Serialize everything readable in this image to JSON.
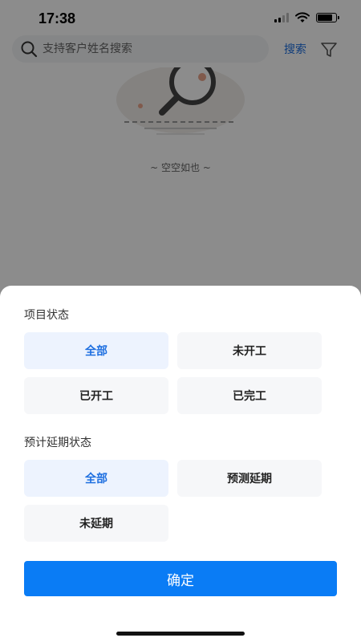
{
  "status_bar": {
    "time": "17:38",
    "icons": [
      "signal-icon",
      "wifi-icon",
      "battery-icon"
    ]
  },
  "search": {
    "placeholder": "支持客户姓名搜索",
    "button_label": "搜索",
    "icons": [
      "search-icon",
      "filter-icon"
    ]
  },
  "empty_state": {
    "text": "~ 空空如也 ~",
    "icon": "empty-magnifier-illustration"
  },
  "filter_sheet": {
    "project_status": {
      "title": "项目状态",
      "options": [
        {
          "label": "全部",
          "selected": true
        },
        {
          "label": "未开工",
          "selected": false
        },
        {
          "label": "已开工",
          "selected": false
        },
        {
          "label": "已完工",
          "selected": false
        }
      ]
    },
    "delay_status": {
      "title": "预计延期状态",
      "options": [
        {
          "label": "全部",
          "selected": true
        },
        {
          "label": "预测延期",
          "selected": false
        },
        {
          "label": "未延期",
          "selected": false
        }
      ]
    },
    "confirm_label": "确定"
  },
  "colors": {
    "accent": "#1e6fe0",
    "confirm_button": "#0a7cf5",
    "selected_bg": "#edf3fe",
    "option_bg": "#f6f7f9",
    "overlay": "rgba(0,0,0,0.45)"
  }
}
